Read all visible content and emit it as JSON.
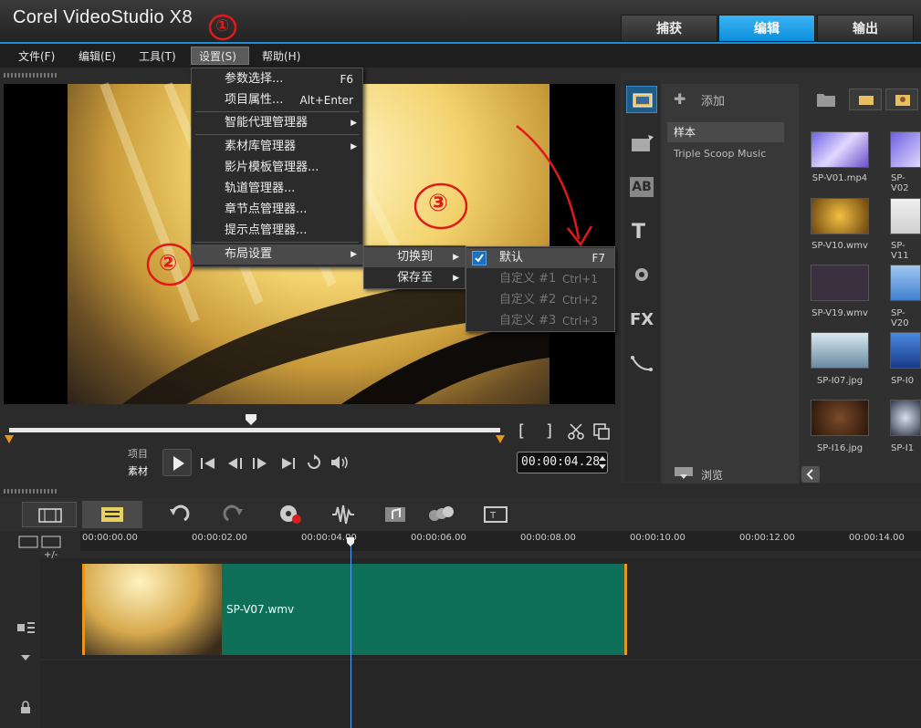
{
  "app": {
    "title": "Corel VideoStudio X8"
  },
  "main_tabs": [
    {
      "label": "捕获"
    },
    {
      "label": "编辑",
      "active": true
    },
    {
      "label": "输出"
    }
  ],
  "menubar": [
    {
      "label": "文件(F)"
    },
    {
      "label": "编辑(E)"
    },
    {
      "label": "工具(T)"
    },
    {
      "label": "设置(S)",
      "open": true
    },
    {
      "label": "帮助(H)"
    }
  ],
  "settings_menu": {
    "items": [
      {
        "label": "参数选择...",
        "shortcut": "F6"
      },
      {
        "label": "项目属性...",
        "shortcut": "Alt+Enter"
      },
      {
        "label": "智能代理管理器",
        "submenu": true
      },
      {
        "label": "素材库管理器",
        "submenu": true
      },
      {
        "label": "影片模板管理器..."
      },
      {
        "label": "轨道管理器..."
      },
      {
        "label": "章节点管理器..."
      },
      {
        "label": "提示点管理器..."
      },
      {
        "label": "布局设置",
        "submenu": true,
        "highlighted": true
      }
    ]
  },
  "layout_submenu": {
    "items": [
      {
        "label": "切换到",
        "highlighted": true
      },
      {
        "label": "保存至"
      }
    ]
  },
  "switch_submenu": {
    "items": [
      {
        "label": "默认",
        "shortcut": "F7",
        "checked": true
      },
      {
        "label": "自定义 #1",
        "shortcut": "Ctrl+1",
        "disabled": true
      },
      {
        "label": "自定义 #2",
        "shortcut": "Ctrl+2",
        "disabled": true
      },
      {
        "label": "自定义 #3",
        "shortcut": "Ctrl+3",
        "disabled": true
      }
    ]
  },
  "annotations": [
    "①",
    "②",
    "③"
  ],
  "player": {
    "mode_project": "项目",
    "mode_clip": "素材",
    "timecode": "00:00:04.28",
    "trim_start": "[",
    "trim_end": "]"
  },
  "library": {
    "add_label": "添加",
    "folders": [
      {
        "label": "样本",
        "selected": true
      },
      {
        "label": "Triple Scoop Music"
      }
    ],
    "browse_label": "浏览",
    "thumbs": [
      {
        "label": "SP-V01.mp4"
      },
      {
        "label": "SP-V02"
      },
      {
        "label": "SP-V10.wmv"
      },
      {
        "label": "SP-V11"
      },
      {
        "label": "SP-V19.wmv"
      },
      {
        "label": "SP-V20"
      },
      {
        "label": "SP-I07.jpg"
      },
      {
        "label": "SP-I0"
      },
      {
        "label": "SP-I16.jpg"
      },
      {
        "label": "SP-I1"
      }
    ],
    "side_icons": [
      "media-icon",
      "instant-project-icon",
      "title-ab-icon",
      "title-t-icon",
      "graphics-icon",
      "fx-icon",
      "path-icon"
    ]
  },
  "timeline": {
    "ruler": [
      "00:00:00.00",
      "00:00:02.00",
      "00:00:04.00",
      "00:00:06.00",
      "00:00:08.00",
      "00:00:10.00",
      "00:00:12.00",
      "00:00:14.00"
    ],
    "zoom_label": "+/-",
    "clip": {
      "label": "SP-V07.wmv"
    }
  },
  "colors": {
    "accent": "#1e8ed8",
    "clip": "#0e7058",
    "clip_edge": "#e8961a",
    "annotation": "#e01a1a"
  }
}
